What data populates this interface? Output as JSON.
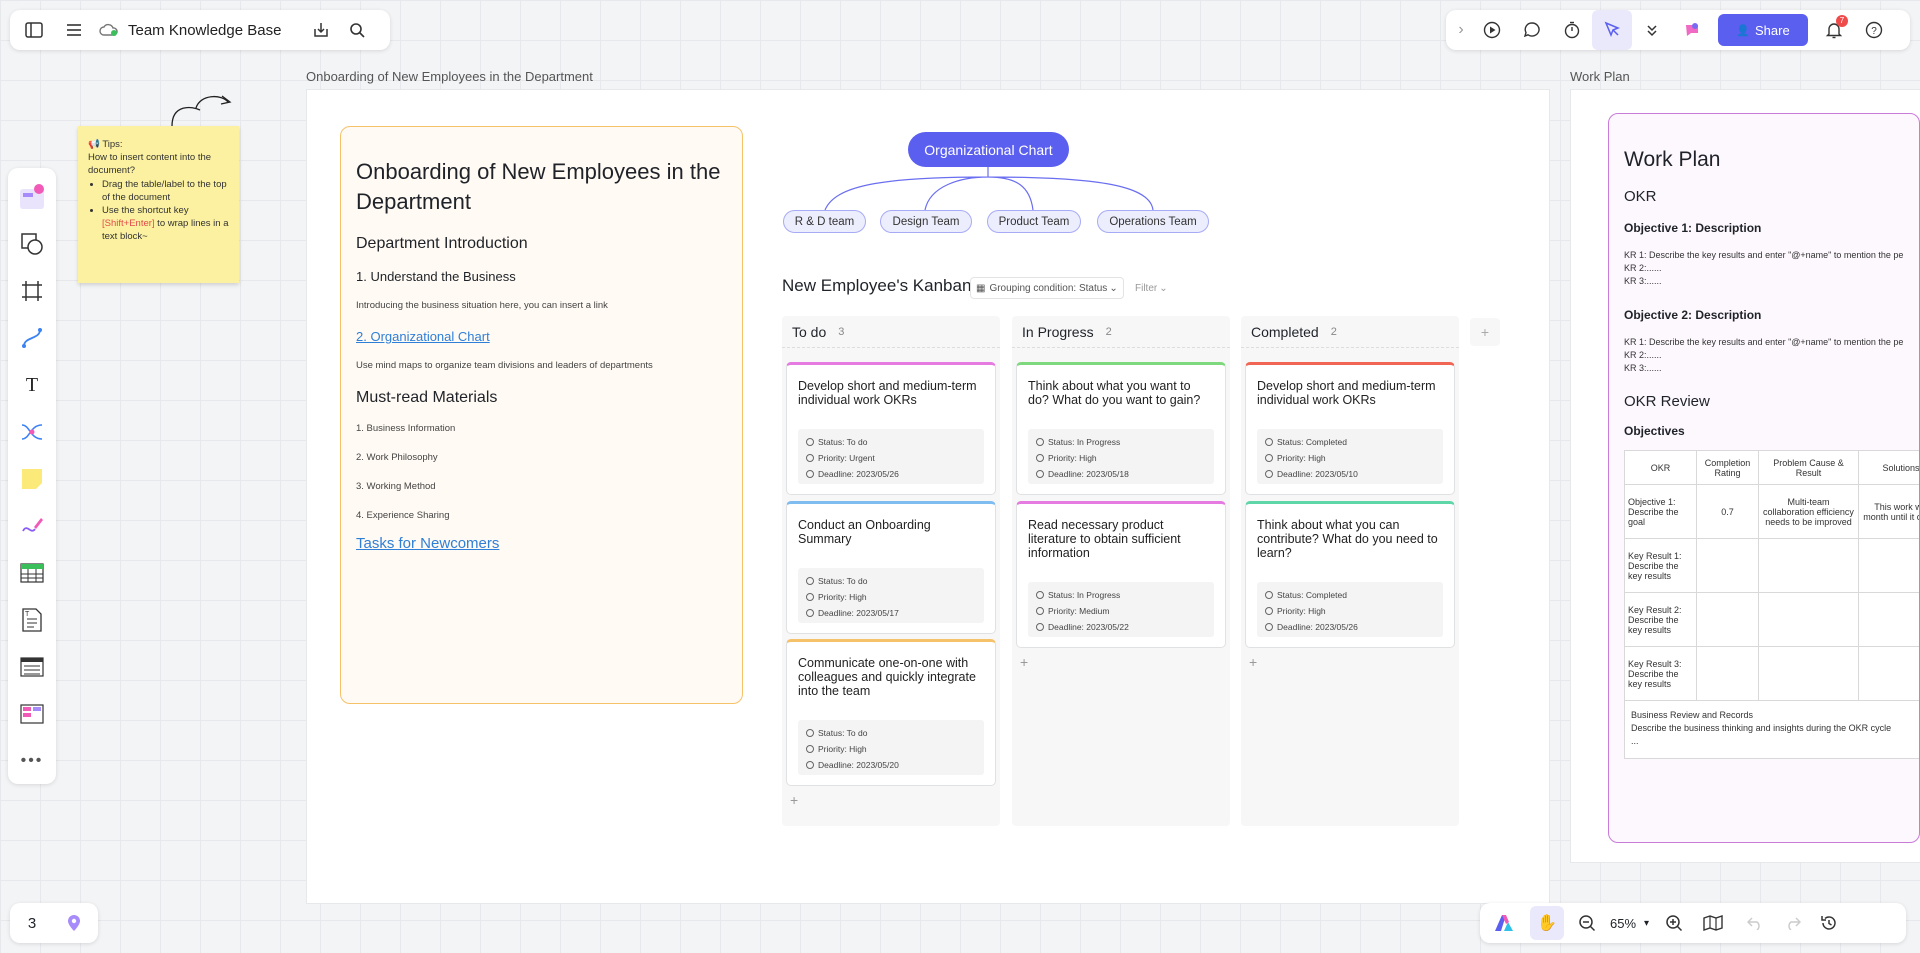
{
  "header": {
    "title": "Team Knowledge Base"
  },
  "topright": {
    "share_label": "Share",
    "notification_count": "7"
  },
  "frames": {
    "onboarding_label": "Onboarding of New Employees in the Department",
    "workplan_label": "Work Plan"
  },
  "sticky": {
    "title": "Tips:",
    "question": "How to insert content into the document?",
    "tip1": "Drag the table/label to the top of the document",
    "tip2_prefix": "Use the shortcut key ",
    "tip2_key": "[Shift+Enter]",
    "tip2_suffix": " to wrap lines in a text block~"
  },
  "doc": {
    "title": "Onboarding of New Employees in the Department",
    "h_dept": "Department Introduction",
    "h_understand": "1. Understand the Business",
    "p_business": "Introducing the business situation here, you can insert a link",
    "link_org": "2. Organizational Chart",
    "p_mindmap": "Use mind maps to organize team divisions and leaders of departments",
    "h_materials": "Must-read Materials",
    "materials": [
      "1. Business Information",
      "2. Work Philosophy",
      "3. Working Method",
      "4. Experience Sharing"
    ],
    "link_tasks": "Tasks for Newcomers"
  },
  "org": {
    "root": "Organizational Chart",
    "nodes": [
      "R & D team",
      "Design Team",
      "Product Team",
      "Operations Team"
    ]
  },
  "kanban": {
    "title": "New Employee's Kanban",
    "grouping": "Grouping condition: Status",
    "filter": "Filter",
    "columns": [
      {
        "name": "To do",
        "count": "3",
        "cards": [
          {
            "title": "Develop short and medium-term individual work OKRs",
            "status": "Status: To do",
            "priority": "Priority: Urgent",
            "deadline": "Deadline: 2023/05/26"
          },
          {
            "title": "Conduct an Onboarding Summary",
            "status": "Status: To do",
            "priority": "Priority: High",
            "deadline": "Deadline: 2023/05/17"
          },
          {
            "title": "Communicate one-on-one with colleagues and quickly integrate into the team",
            "status": "Status: To do",
            "priority": "Priority: High",
            "deadline": "Deadline: 2023/05/20"
          }
        ]
      },
      {
        "name": "In Progress",
        "count": "2",
        "cards": [
          {
            "title": "Think about what you want to do? What do you want to gain?",
            "status": "Status: In Progress",
            "priority": "Priority: High",
            "deadline": "Deadline: 2023/05/18"
          },
          {
            "title": "Read necessary product literature to obtain sufficient information",
            "status": "Status: In Progress",
            "priority": "Priority: Medium",
            "deadline": "Deadline: 2023/05/22"
          }
        ]
      },
      {
        "name": "Completed",
        "count": "2",
        "cards": [
          {
            "title": "Develop short and medium-term individual work OKRs",
            "status": "Status: Completed",
            "priority": "Priority: High",
            "deadline": "Deadline: 2023/05/10"
          },
          {
            "title": "Think about what you can contribute? What do you need to learn?",
            "status": "Status: Completed",
            "priority": "Priority: High",
            "deadline": "Deadline: 2023/05/26"
          }
        ]
      }
    ]
  },
  "workplan": {
    "title": "Work Plan",
    "okr": "OKR",
    "obj1": "Objective 1: Description",
    "obj1_kr1": "KR 1: Describe the key results and enter \"@+name\" to mention the pe",
    "obj1_kr2": "KR 2:......",
    "obj1_kr3": "KR 3:......",
    "obj2": "Objective 2: Description",
    "obj2_kr1": "KR 1: Describe the key results and enter \"@+name\" to mention the pe",
    "obj2_kr2": "KR 2:......",
    "obj2_kr3": "KR 3:......",
    "review": "OKR Review",
    "objectives": "Objectives",
    "table_headers": [
      "OKR",
      "Completion Rating",
      "Problem Cause & Result",
      "Solutions"
    ],
    "row1": [
      "Objective 1: Describe the goal",
      "0.7",
      "Multi-team collaboration efficiency needs to be improved",
      "This work will month until it comp"
    ],
    "row_labels": [
      "Key Result 1: Describe the key results",
      "Key Result 2: Describe the key results",
      "Key Result 3: Describe the key results"
    ],
    "records_title": "Business Review and Records",
    "records_text": "Describe the business thinking and insights during the OKR cycle",
    "records_more": "..."
  },
  "bottom": {
    "page_number": "3",
    "zoom": "65%"
  },
  "colors": {
    "accent": "#5b5ff0",
    "todo_stripe": "#e57ae0",
    "progress_stripe": "#7ed87e",
    "done_stripe": "#f06553",
    "sticky": "#fbf1a0"
  }
}
